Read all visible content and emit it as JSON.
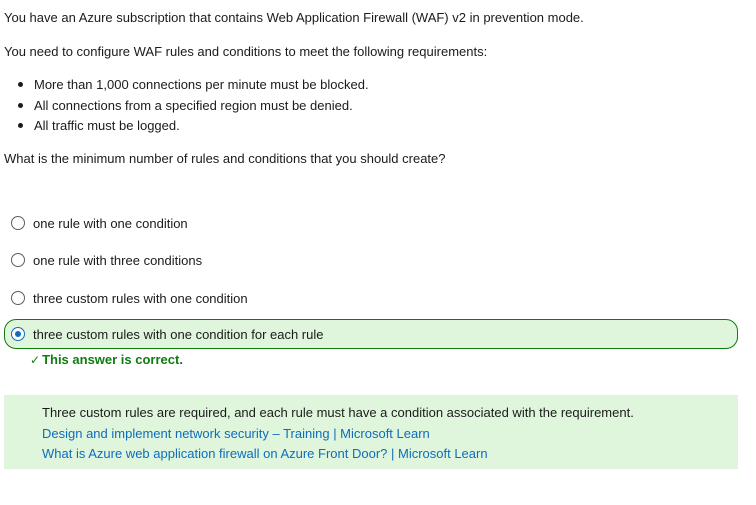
{
  "question": {
    "intro": "You have an Azure subscription that contains Web Application Firewall (WAF) v2 in prevention mode.",
    "requirement": "You need to configure WAF rules and conditions to meet the following requirements:",
    "requirements": [
      "More than 1,000 connections per minute must be blocked.",
      "All connections from a specified region must be denied.",
      "All traffic must be logged."
    ],
    "prompt": "What is the minimum number of rules and conditions that you should create?"
  },
  "options": [
    {
      "label": "one rule with one condition",
      "selected": false
    },
    {
      "label": "one rule with three conditions",
      "selected": false
    },
    {
      "label": "three custom rules with one condition",
      "selected": false
    },
    {
      "label": "three custom rules with one condition for each rule",
      "selected": true
    }
  ],
  "feedback": {
    "check_glyph": "✓",
    "text": "This answer is correct."
  },
  "explanation": {
    "text": "Three custom rules are required, and each rule must have a condition associated with the requirement.",
    "links": [
      "Design and implement network security – Training | Microsoft Learn",
      "What is Azure web application firewall on Azure Front Door? | Microsoft Learn"
    ]
  },
  "colors": {
    "correct_green": "#107c10",
    "correct_bg": "#dff6dd",
    "link_blue": "#0f6cbd",
    "radio_selected": "#0f6cbd"
  }
}
